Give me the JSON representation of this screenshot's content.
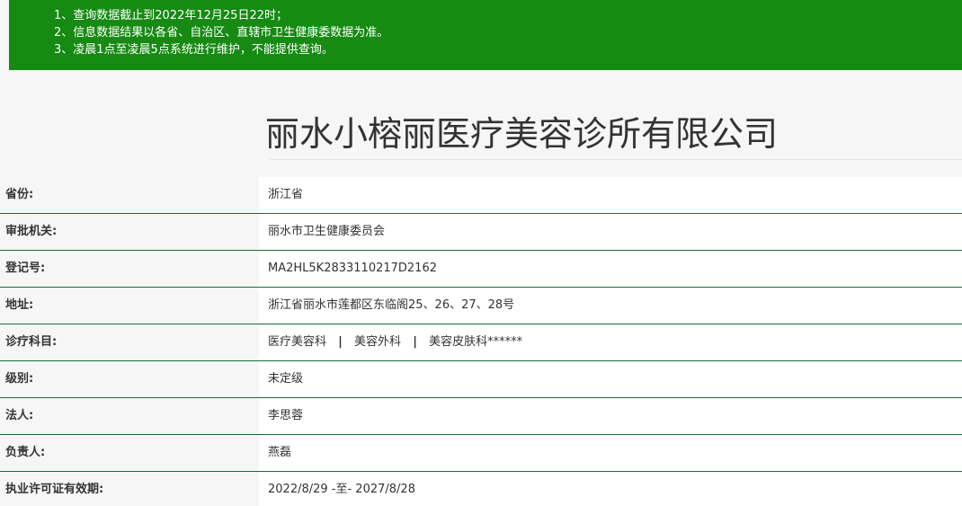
{
  "notice": {
    "lines": [
      "1、查询数据截止到2022年12月25日22时；",
      "2、信息数据结果以各省、自治区、直辖市卫生健康委数据为准。",
      "3、凌晨1点至凌晨5点系统进行维护，不能提供查询。"
    ],
    "background_color": "#168a12"
  },
  "org_title": "丽水小榕丽医疗美容诊所有限公司",
  "rows": [
    {
      "label": "省份:",
      "value": "浙江省"
    },
    {
      "label": "审批机关:",
      "value": "丽水市卫生健康委员会"
    },
    {
      "label": "登记号:",
      "value": "MA2HL5K2833110217D2162"
    },
    {
      "label": "地址:",
      "value": "浙江省丽水市莲都区东临阁25、26、27、28号"
    },
    {
      "label": "诊疗科目:",
      "departments": [
        "医疗美容科",
        "美容外科",
        "美容皮肤科******"
      ],
      "separator": "|"
    },
    {
      "label": "级别:",
      "value": "未定级"
    },
    {
      "label": "法人:",
      "value": "李思蓉"
    },
    {
      "label": "负责人:",
      "value": "燕磊"
    },
    {
      "label": "执业许可证有效期:",
      "value": "2022/8/29 -至- 2027/8/28"
    }
  ]
}
